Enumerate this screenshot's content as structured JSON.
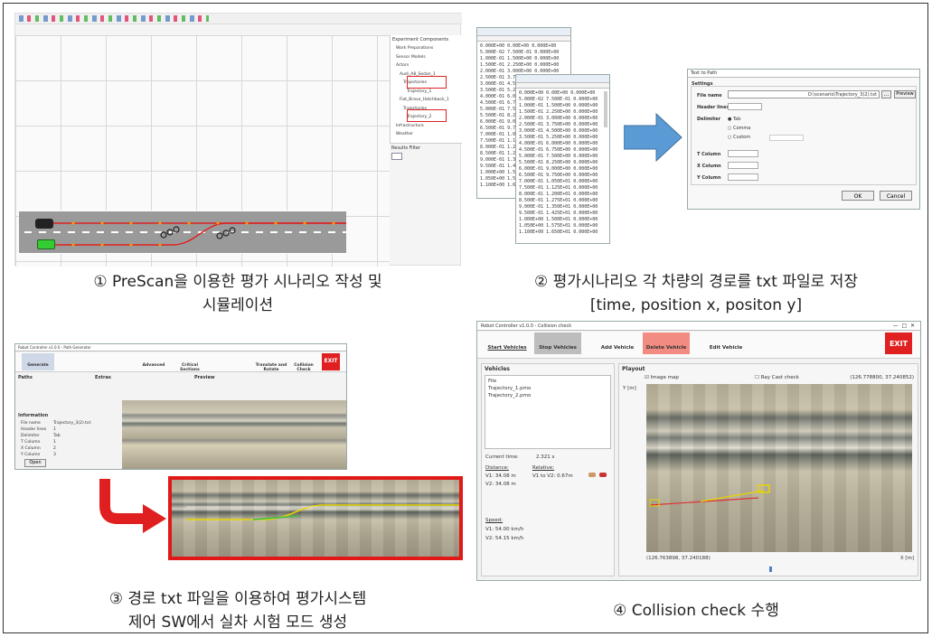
{
  "captions": {
    "c1_line1": "① PreScan을 이용한 평가 시나리오 작성 및",
    "c1_line2": "시뮬레이션",
    "c2_line1": "② 평가시나리오 각 차량의 경로를 txt 파일로 저장",
    "c2_line2": "[time, position x, positon y]",
    "c3_line1": "③ 경로 txt 파일을 이용하여 평가시스템",
    "c3_line2": "제어 SW에서 실차 시험 모드 생성",
    "c4_line1": "④ Collision check 수행"
  },
  "panel1": {
    "tree_title": "Experiment Components",
    "tree_items": [
      "Work Preparations",
      "Sensor Models",
      "Actors",
      "Audi_A8_Sedan_1",
      "Trajectories",
      "Trajectory_1",
      "Fiat_Bravo_Hatchback_1",
      "Trajectories",
      "Trajectory_2",
      "Infrastructure",
      "Weather"
    ],
    "filter_label": "Results Filter"
  },
  "panel2": {
    "data_rows": [
      "0.000E+00 0.00E+00 0.000E+00",
      "5.000E-02 7.500E-01 0.000E+00",
      "1.000E-01 1.500E+00 0.000E+00",
      "1.500E-01 2.250E+00 0.000E+00",
      "2.000E-01 3.000E+00 0.000E+00",
      "2.500E-01 3.750E+00 0.000E+00",
      "3.000E-01 4.500E+00 0.000E+00",
      "3.500E-01 5.250E+00 0.000E+00",
      "4.000E-01 6.000E+00 0.000E+00",
      "4.500E-01 6.750E+00 0.000E+00",
      "5.000E-01 7.500E+00 0.000E+00",
      "5.500E-01 8.250E+00 0.000E+00",
      "6.000E-01 9.000E+00 0.000E+00",
      "6.500E-01 9.750E+00 0.000E+00",
      "7.000E-01 1.050E+01 0.000E+00",
      "7.500E-01 1.125E+01 0.000E+00",
      "8.000E-01 1.200E+01 0.000E+00",
      "8.500E-01 1.275E+01 0.000E+00",
      "9.000E-01 1.350E+01 0.000E+00",
      "9.500E-01 1.425E+01 0.000E+00",
      "1.000E+00 1.500E+01 0.000E+00",
      "1.050E+00 1.575E+01 0.000E+00",
      "1.100E+00 1.650E+01 0.000E+00"
    ],
    "dialog_title": "Text to Path",
    "settings_label": "Settings",
    "file_name_label": "File name",
    "file_name_value": "D:\\scenario\\Trajectory_3(2).txt",
    "browse_label": "...",
    "preview_label": "Preview",
    "header_lines_label": "Header lines",
    "delimiter_label": "Delimiter",
    "delim_tab": "Tab",
    "delim_comma": "Comma",
    "delim_custom": "Custom",
    "t_col": "T Column",
    "x_col": "X Column",
    "y_col": "Y Column",
    "ok": "OK",
    "cancel": "Cancel"
  },
  "panel3": {
    "title": "Robot Controller v1.0.0 - Path Generator",
    "tools": [
      "Generate",
      "",
      "",
      "Advanced",
      "Critical Sections",
      "",
      "Translate and Rotate",
      "Collision Check",
      "EXIT"
    ],
    "paths_label": "Paths",
    "extras_label": "Extras",
    "preview_label": "Preview",
    "info_label": "Information",
    "info_rows": [
      [
        "File name",
        "Trajectory_3(2).txt"
      ],
      [
        "Header lines",
        "1"
      ],
      [
        "Delimiter",
        "Tab"
      ],
      [
        "T Column",
        "1"
      ],
      [
        "X Column",
        "2"
      ],
      [
        "Y Column",
        "3"
      ]
    ],
    "open_btn": "Open"
  },
  "panel4": {
    "title": "Robot Controller v1.0.0 - Collision check",
    "toolbar": [
      "Start Vehicles",
      "Stop Vehicles",
      "Add Vehicle",
      "Delete Vehicle",
      "Edit Vehicle",
      "EXIT"
    ],
    "vehicles_label": "Vehicles",
    "vehicle_list": [
      "File",
      "Trajectory_1.pmo",
      "Trajectory_2.pmo"
    ],
    "playout_label": "Playout",
    "image_map": "Image map",
    "ray_cast": "Ray Cast check",
    "coord_top": "(126.778800, 37.240852)",
    "coord_bottom": "(126.763898, 37.240188)",
    "y_label": "Y [m]",
    "x_label": "X [m]",
    "current_time_label": "Current time:",
    "current_time_value": "2.321 s",
    "distance_label": "Distance:",
    "relative_label": "Relative:",
    "v1_dist": "V1:  34.08 m",
    "v2_dist": "V2:  34.08 m",
    "rel_value": "V1 to V2:  0.67m",
    "speed_label": "Speed:",
    "v1_speed": "V1:  54.00 km/h",
    "v2_speed": "V2:  54.15 km/h"
  }
}
